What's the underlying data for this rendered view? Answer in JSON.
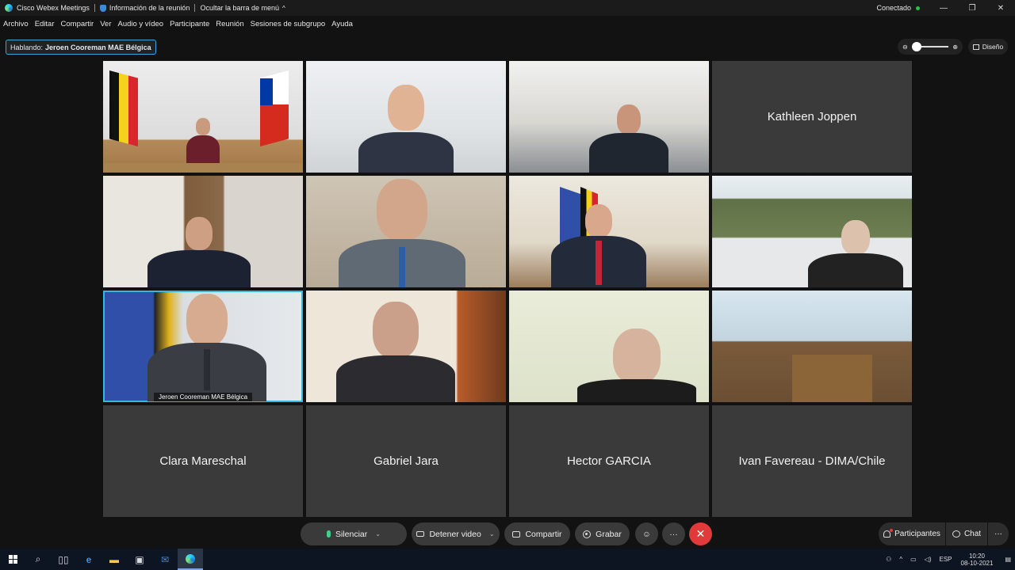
{
  "titlebar": {
    "app_name": "Cisco Webex Meetings",
    "meeting_info": "Información de la reunión",
    "hide_menu": "Ocultar la barra de menú",
    "status": "Conectado",
    "minimize": "—",
    "restore": "❐",
    "close": "✕"
  },
  "menu": [
    "Archivo",
    "Editar",
    "Compartir",
    "Ver",
    "Audio y vídeo",
    "Participante",
    "Reunión",
    "Sesiones de subgrupo",
    "Ayuda"
  ],
  "speaking": {
    "label": "Hablando:",
    "name": "Jeroen Cooreman MAE Bélgica"
  },
  "zoom": {
    "minus": "⊖",
    "plus": "⊕",
    "level": 0.0
  },
  "design_label": "Diseño",
  "tiles": {
    "t4": "Kathleen Joppen",
    "t9_caption": "Jeroen Cooreman MAE Bélgica",
    "t13": "Clara Mareschal",
    "t14": "Gabriel Jara",
    "t15": "Hector GARCIA",
    "t16": "Ivan Favereau - DIMA/Chile"
  },
  "toolbar": {
    "mute": "Silenciar",
    "stop_video": "Detener video",
    "share": "Compartir",
    "record": "Grabar",
    "reactions": "☺",
    "more": "···",
    "end": "✕",
    "caret": "⌄"
  },
  "side": {
    "participants": "Participantes",
    "chat": "Chat",
    "more": "···"
  },
  "taskbar": {
    "lang": "ESP",
    "time": "10:20",
    "date": "08-10-2021"
  }
}
